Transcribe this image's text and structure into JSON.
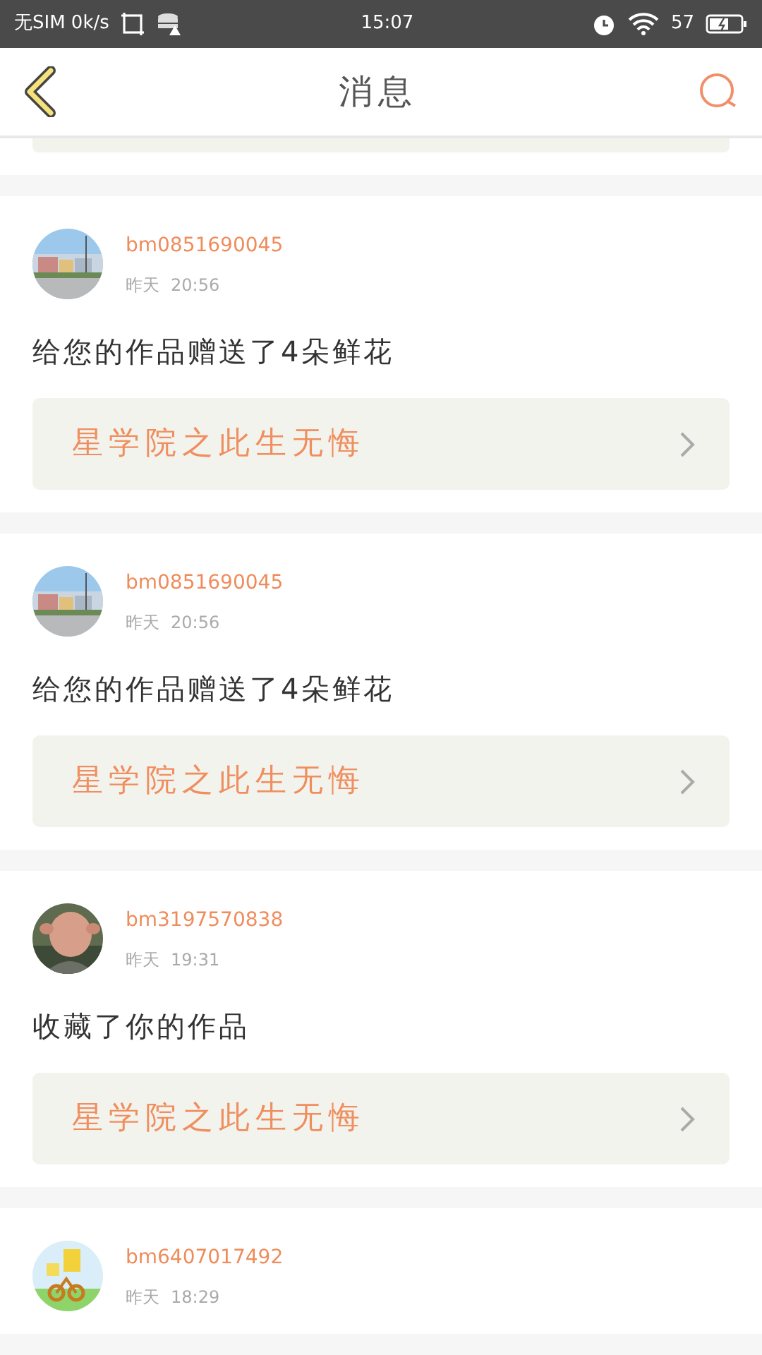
{
  "status_bar": {
    "carrier": "无SIM 0k/s",
    "time": "15:07",
    "battery": "57"
  },
  "header": {
    "title": "消息"
  },
  "messages": [
    {
      "user": "bm0851690045",
      "day": "昨天",
      "time": "20:56",
      "text": "给您的作品赠送了4朵鲜花",
      "work": "星学院之此生无悔"
    },
    {
      "user": "bm0851690045",
      "day": "昨天",
      "time": "20:56",
      "text": "给您的作品赠送了4朵鲜花",
      "work": "星学院之此生无悔"
    },
    {
      "user": "bm3197570838",
      "day": "昨天",
      "time": "19:31",
      "text": "收藏了你的作品",
      "work": "星学院之此生无悔"
    },
    {
      "user": "bm6407017492",
      "day": "昨天",
      "time": "18:29"
    }
  ]
}
